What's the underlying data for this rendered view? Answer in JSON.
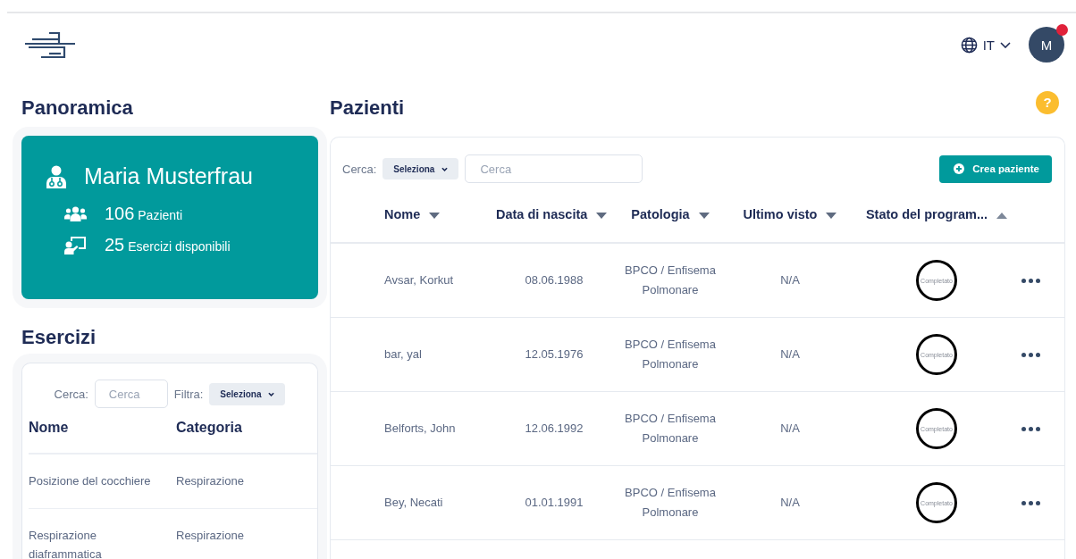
{
  "header": {
    "language": "IT",
    "avatar_initial": "M",
    "notification": true
  },
  "overview": {
    "title": "Panoramica",
    "doctor_name": "Maria Musterfrau",
    "stats": [
      {
        "kind": "patients",
        "count": "106",
        "label": "Pazienti"
      },
      {
        "kind": "exercises",
        "count": "25",
        "label": "Esercizi disponibili"
      }
    ]
  },
  "exercises": {
    "title": "Esercizi",
    "search_label": "Cerca:",
    "search": {
      "placeholder": "Cerca"
    },
    "filter_label": "Filtra:",
    "filter": {
      "value": "Seleziona"
    },
    "columns": [
      "Nome",
      "Categoria"
    ],
    "rows": [
      [
        "Posizione del cocchiere",
        "Respirazione"
      ],
      [
        "Respirazione diaframmatica",
        "Respirazione"
      ]
    ]
  },
  "patients": {
    "title": "Pazienti",
    "help": "?",
    "search_label": "Cerca:",
    "search_select": {
      "value": "Seleziona"
    },
    "search": {
      "placeholder": "Cerca"
    },
    "create_button": "Crea paziente",
    "columns": [
      {
        "label": "Nome",
        "sorted": false
      },
      {
        "label": "Data di nascita",
        "sorted": false
      },
      {
        "label": "Patologia",
        "sorted": false
      },
      {
        "label": "Ultimo visto",
        "sorted": false
      },
      {
        "label": "Stato del program...",
        "sorted": true
      }
    ],
    "rows": [
      {
        "name": "Avsar, Korkut",
        "birth_date": "08.06.1988",
        "pathology": "BPCO / Enfisema Polmonare",
        "last_seen": "N/A",
        "status": "Completato"
      },
      {
        "name": "bar, yal",
        "birth_date": "12.05.1976",
        "pathology": "BPCO / Enfisema Polmonare",
        "last_seen": "N/A",
        "status": "Completato"
      },
      {
        "name": "Belforts, John",
        "birth_date": "12.06.1992",
        "pathology": "BPCO / Enfisema Polmonare",
        "last_seen": "N/A",
        "status": "Completato"
      },
      {
        "name": "Bey, Necati",
        "birth_date": "01.01.1991",
        "pathology": "BPCO / Enfisema Polmonare",
        "last_seen": "N/A",
        "status": "Completato"
      }
    ]
  }
}
